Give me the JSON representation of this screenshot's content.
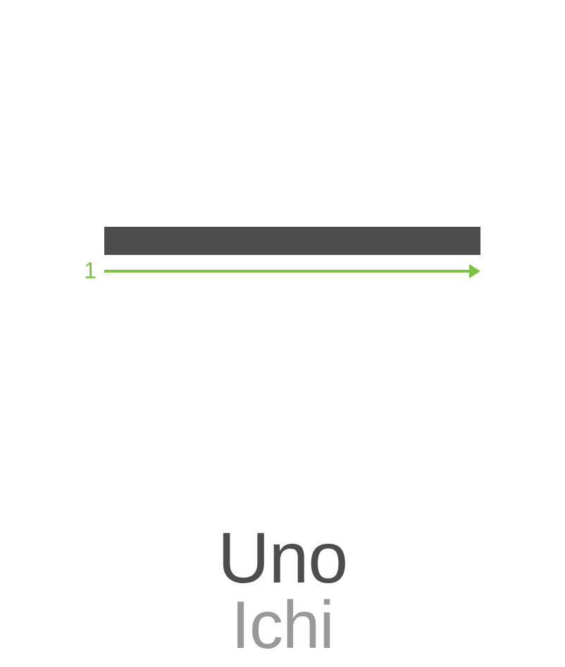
{
  "diagram": {
    "stroke_count": 1,
    "strokes": [
      {
        "number_label": "1",
        "direction": "left-to-right"
      }
    ]
  },
  "words": {
    "primary": "Uno",
    "secondary": "Ichi"
  },
  "colors": {
    "stroke": "#4d4d4d",
    "arrow": "#7dc242",
    "primary_text": "#4d4d4d",
    "secondary_text": "#999999",
    "background": "#ffffff"
  }
}
